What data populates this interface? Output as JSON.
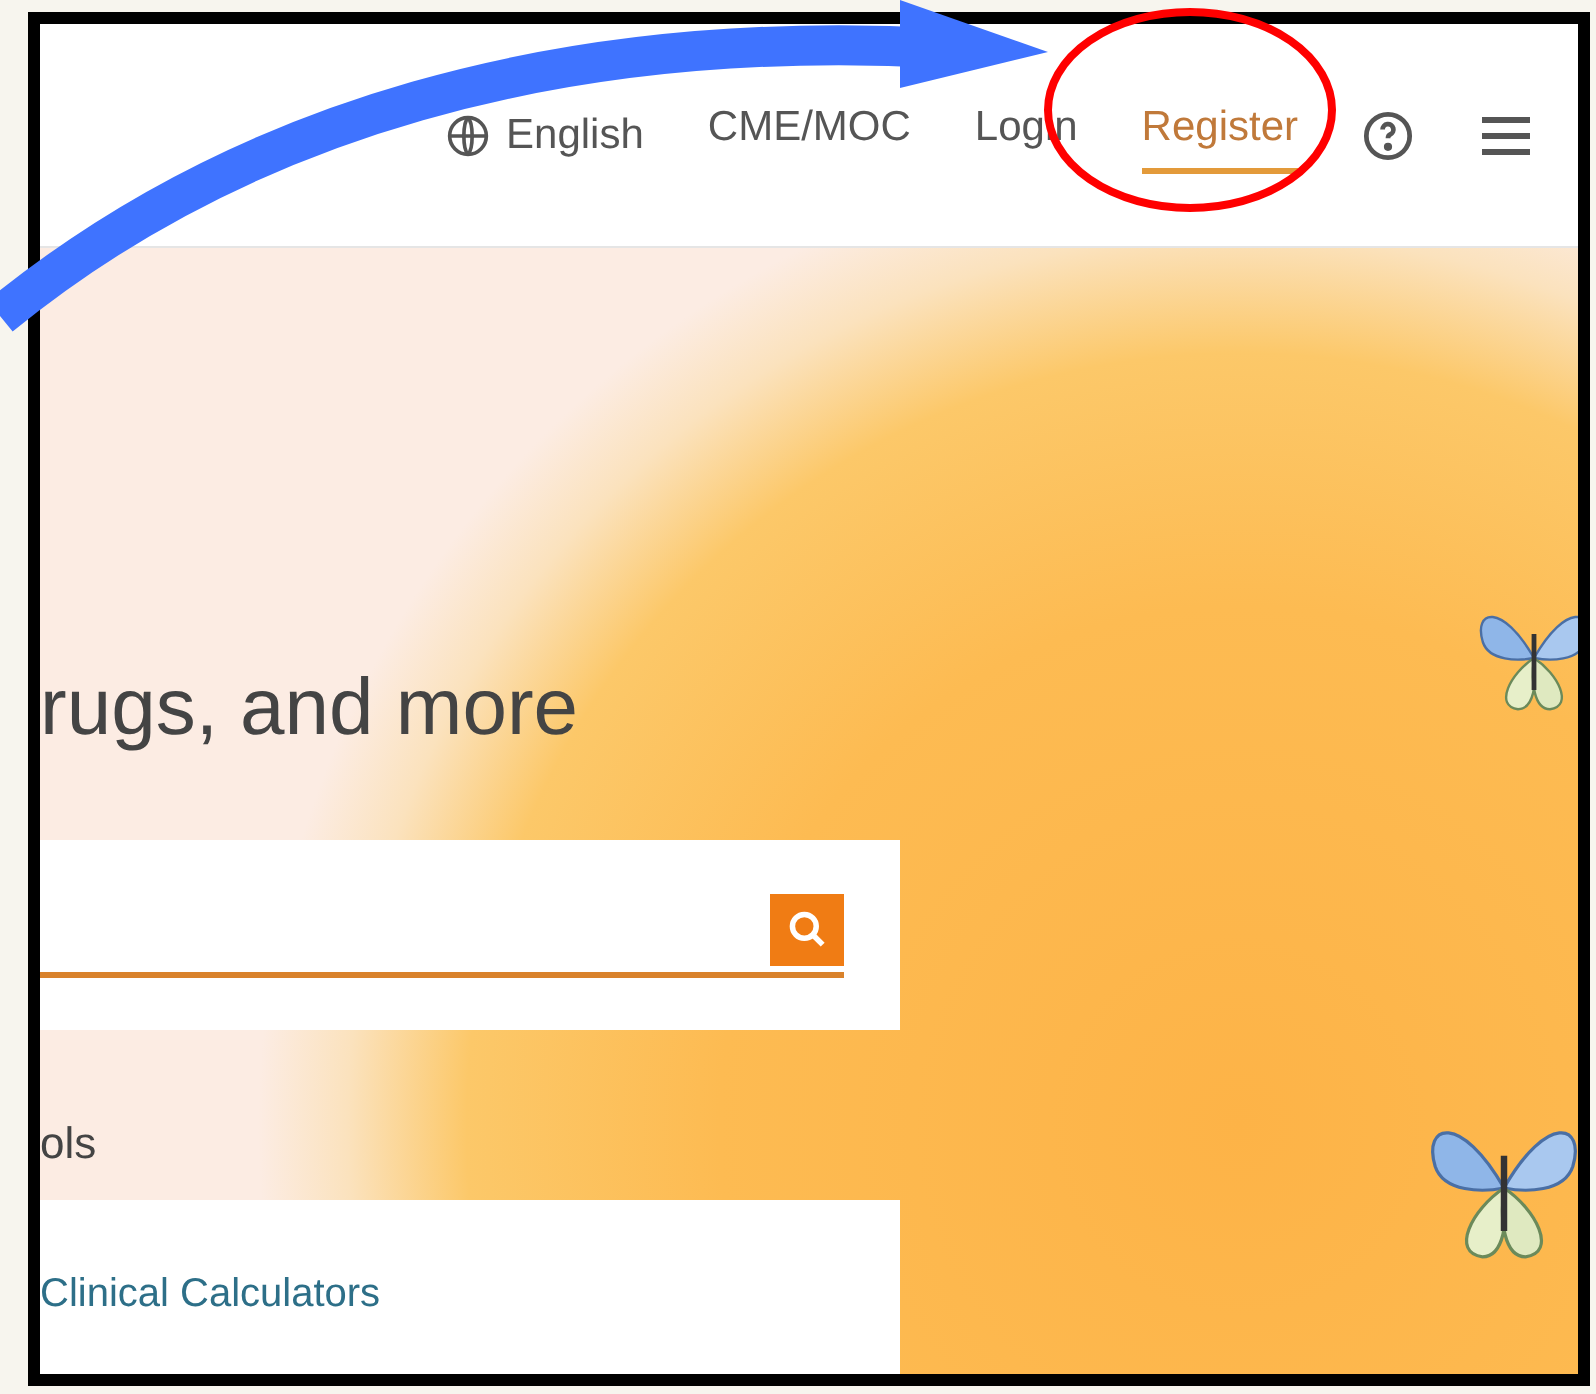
{
  "header": {
    "nav": [
      {
        "kind": "language",
        "label": "English",
        "selected": false
      },
      {
        "kind": "link",
        "label": "CME/MOC",
        "selected": false
      },
      {
        "kind": "link",
        "label": "Login",
        "selected": false
      },
      {
        "kind": "link",
        "label": "Register",
        "selected": true
      }
    ]
  },
  "hero": {
    "heading": "rugs, and more",
    "section_label": "ols",
    "links": [
      "Clinical Calculators"
    ]
  }
}
